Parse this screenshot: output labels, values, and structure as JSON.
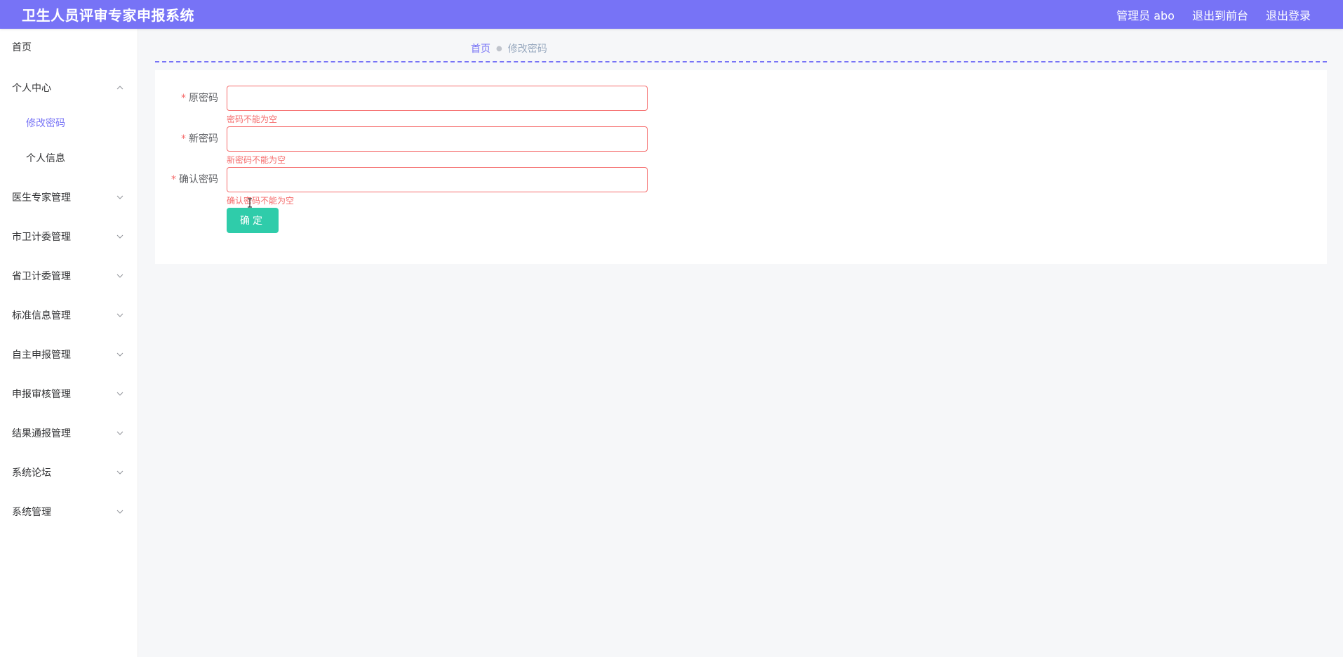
{
  "header": {
    "title": "卫生人员评审专家申报系统",
    "user_label": "管理员 abo",
    "front_label": "退出到前台",
    "logout_label": "退出登录"
  },
  "sidebar": {
    "items": [
      {
        "label": "首页",
        "expandable": false
      },
      {
        "label": "个人中心",
        "expandable": true,
        "expanded": true
      },
      {
        "label": "修改密码",
        "sub": true,
        "active": true
      },
      {
        "label": "个人信息",
        "sub": true
      },
      {
        "label": "医生专家管理",
        "expandable": true
      },
      {
        "label": "市卫计委管理",
        "expandable": true
      },
      {
        "label": "省卫计委管理",
        "expandable": true
      },
      {
        "label": "标准信息管理",
        "expandable": true
      },
      {
        "label": "自主申报管理",
        "expandable": true
      },
      {
        "label": "申报审核管理",
        "expandable": true
      },
      {
        "label": "结果通报管理",
        "expandable": true
      },
      {
        "label": "系统论坛",
        "expandable": true
      },
      {
        "label": "系统管理",
        "expandable": true
      }
    ]
  },
  "breadcrumb": {
    "home": "首页",
    "separator": "●",
    "current": "修改密码"
  },
  "form": {
    "fields": [
      {
        "required_mark": "*",
        "label": "原密码",
        "value": "",
        "error": "密码不能为空"
      },
      {
        "required_mark": "*",
        "label": "新密码",
        "value": "",
        "error": "新密码不能为空"
      },
      {
        "required_mark": "*",
        "label": "确认密码",
        "value": "",
        "error": "确认密码不能为空"
      }
    ],
    "submit_label": "确定"
  },
  "colors": {
    "accent": "#7773f6",
    "error": "#f56c6c",
    "button": "#2fccaa"
  }
}
